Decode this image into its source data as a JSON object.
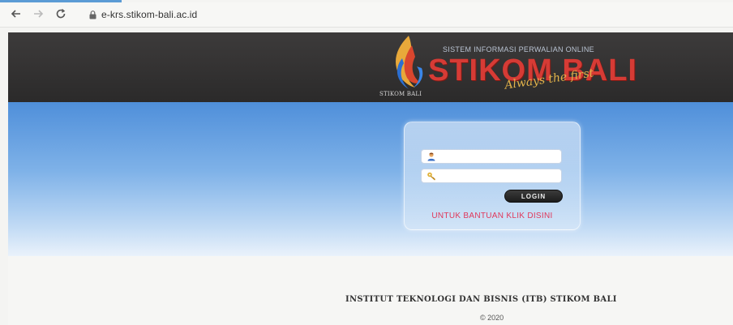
{
  "browser": {
    "url": "e-krs.stikom-bali.ac.id",
    "icons": [
      "back-arrow-icon",
      "forward-arrow-icon",
      "reload-icon",
      "lock-icon"
    ]
  },
  "header": {
    "logo_small": "STIKOM BALI",
    "logo_subtitle": "SISTEM INFORMASI PERWALIAN ONLINE",
    "logo_title": "STIKOM BALI",
    "logo_tagline": "Always the first"
  },
  "login": {
    "username_value": "",
    "password_value": "",
    "button_label": "LOGIN",
    "help_link": "UNTUK BANTUAN KLIK DISINI",
    "icons": [
      "user-icon",
      "key-icon"
    ]
  },
  "footer": {
    "title": "INSTITUT TEKNOLOGI DAN BISNIS (ITB) STIKOM BALI",
    "copyright": "© 2020"
  },
  "colors": {
    "header_bg": "#333131",
    "logo_red": "#d63b35",
    "help_link": "#e0385b",
    "sky_blue": "#4f8fda"
  }
}
